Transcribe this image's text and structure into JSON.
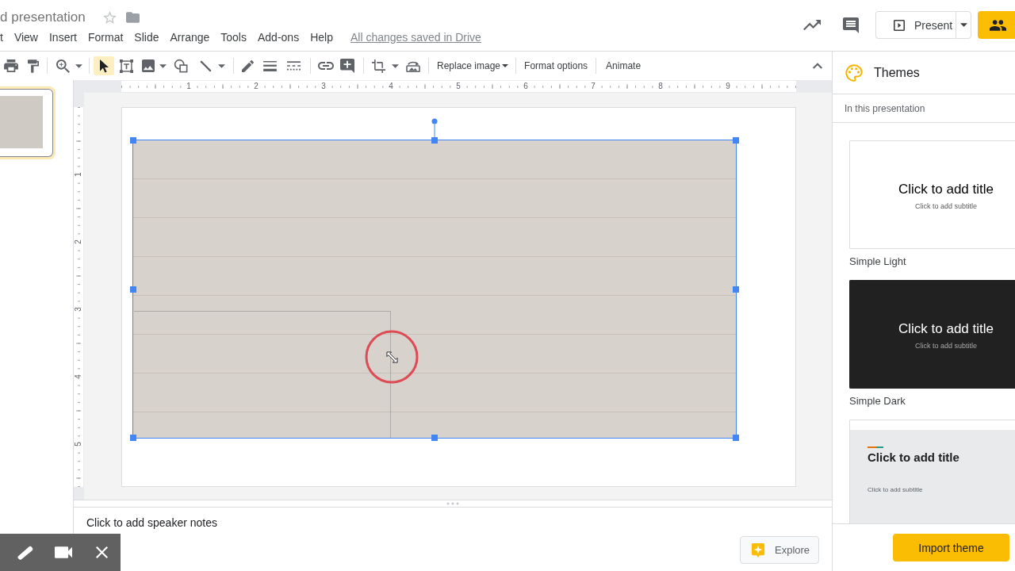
{
  "document": {
    "title": "d presentation",
    "starred": false
  },
  "menu": [
    "t",
    "View",
    "Insert",
    "Format",
    "Slide",
    "Arrange",
    "Tools",
    "Add-ons",
    "Help"
  ],
  "save_status": "All changes saved in Drive",
  "header": {
    "present": "Present"
  },
  "toolbar": {
    "tools": [
      {
        "selected": true
      },
      {
        "selected": false
      },
      {
        "selected": false
      },
      {
        "selected": false
      },
      {
        "selected": false
      }
    ],
    "actions": [
      "Replace image",
      "Format options",
      "Animate"
    ]
  },
  "filmstrip": {
    "slides": [
      {
        "selected": true
      }
    ]
  },
  "rulers": {
    "horizontal": [
      "1",
      "2",
      "3",
      "4",
      "5",
      "6",
      "7",
      "8",
      "9"
    ],
    "vertical": [
      "1",
      "2",
      "3",
      "4",
      "5"
    ]
  },
  "slide": {
    "image": {
      "selected": true
    }
  },
  "speaker_notes": {
    "placeholder": "Click to add speaker notes"
  },
  "explore": "Explore",
  "themes": {
    "title": "Themes",
    "section": "In this presentation",
    "items": [
      {
        "name": "Simple Light",
        "kind": "light",
        "title": "Click to add title",
        "subtitle": "Click to add subtitle"
      },
      {
        "name": "Simple Dark",
        "kind": "dark",
        "title": "Click to add title",
        "subtitle": "Click to add subtitle"
      },
      {
        "kind": "accent",
        "title": "Click to add title",
        "subtitle": "Click to add subtitle"
      }
    ],
    "import_button": "Import theme"
  }
}
